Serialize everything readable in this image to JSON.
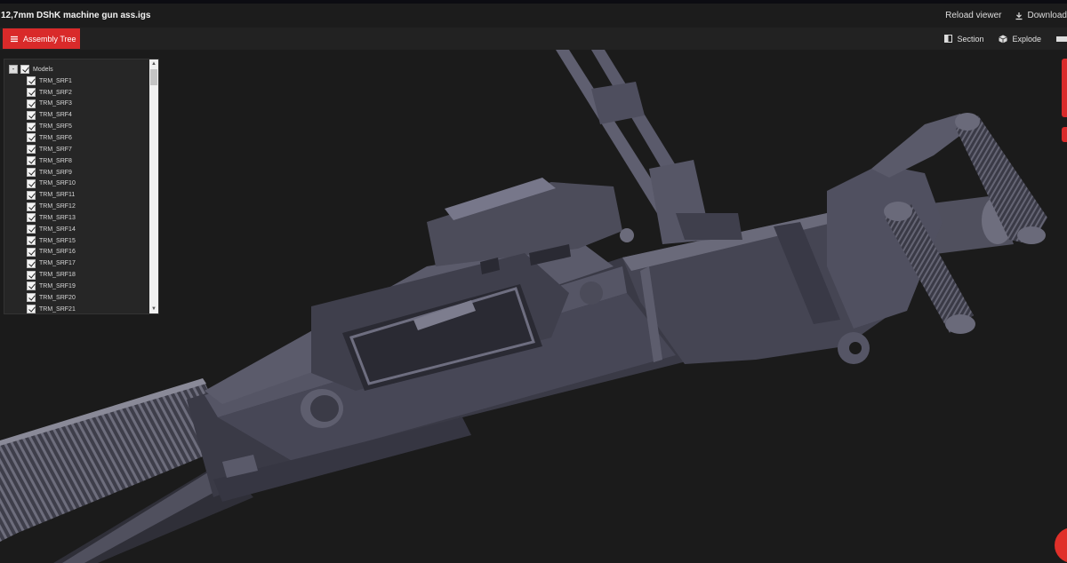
{
  "window": {
    "title": "12,7mm DShK machine gun ass.igs"
  },
  "title_actions": {
    "reload_label": "Reload viewer",
    "download_label": "Download"
  },
  "toolbar": {
    "assembly_tree_label": "Assembly Tree",
    "section_label": "Section",
    "explode_label": "Explode"
  },
  "tree": {
    "root_label": "Models",
    "expander": "-",
    "items": [
      "TRM_SRF1",
      "TRM_SRF2",
      "TRM_SRF3",
      "TRM_SRF4",
      "TRM_SRF5",
      "TRM_SRF6",
      "TRM_SRF7",
      "TRM_SRF8",
      "TRM_SRF9",
      "TRM_SRF10",
      "TRM_SRF11",
      "TRM_SRF12",
      "TRM_SRF13",
      "TRM_SRF14",
      "TRM_SRF15",
      "TRM_SRF16",
      "TRM_SRF17",
      "TRM_SRF18",
      "TRM_SRF19",
      "TRM_SRF20",
      "TRM_SRF21"
    ]
  },
  "colors": {
    "accent": "#d92a2a",
    "background": "#1b1b1b",
    "model": "#4a4a58"
  }
}
